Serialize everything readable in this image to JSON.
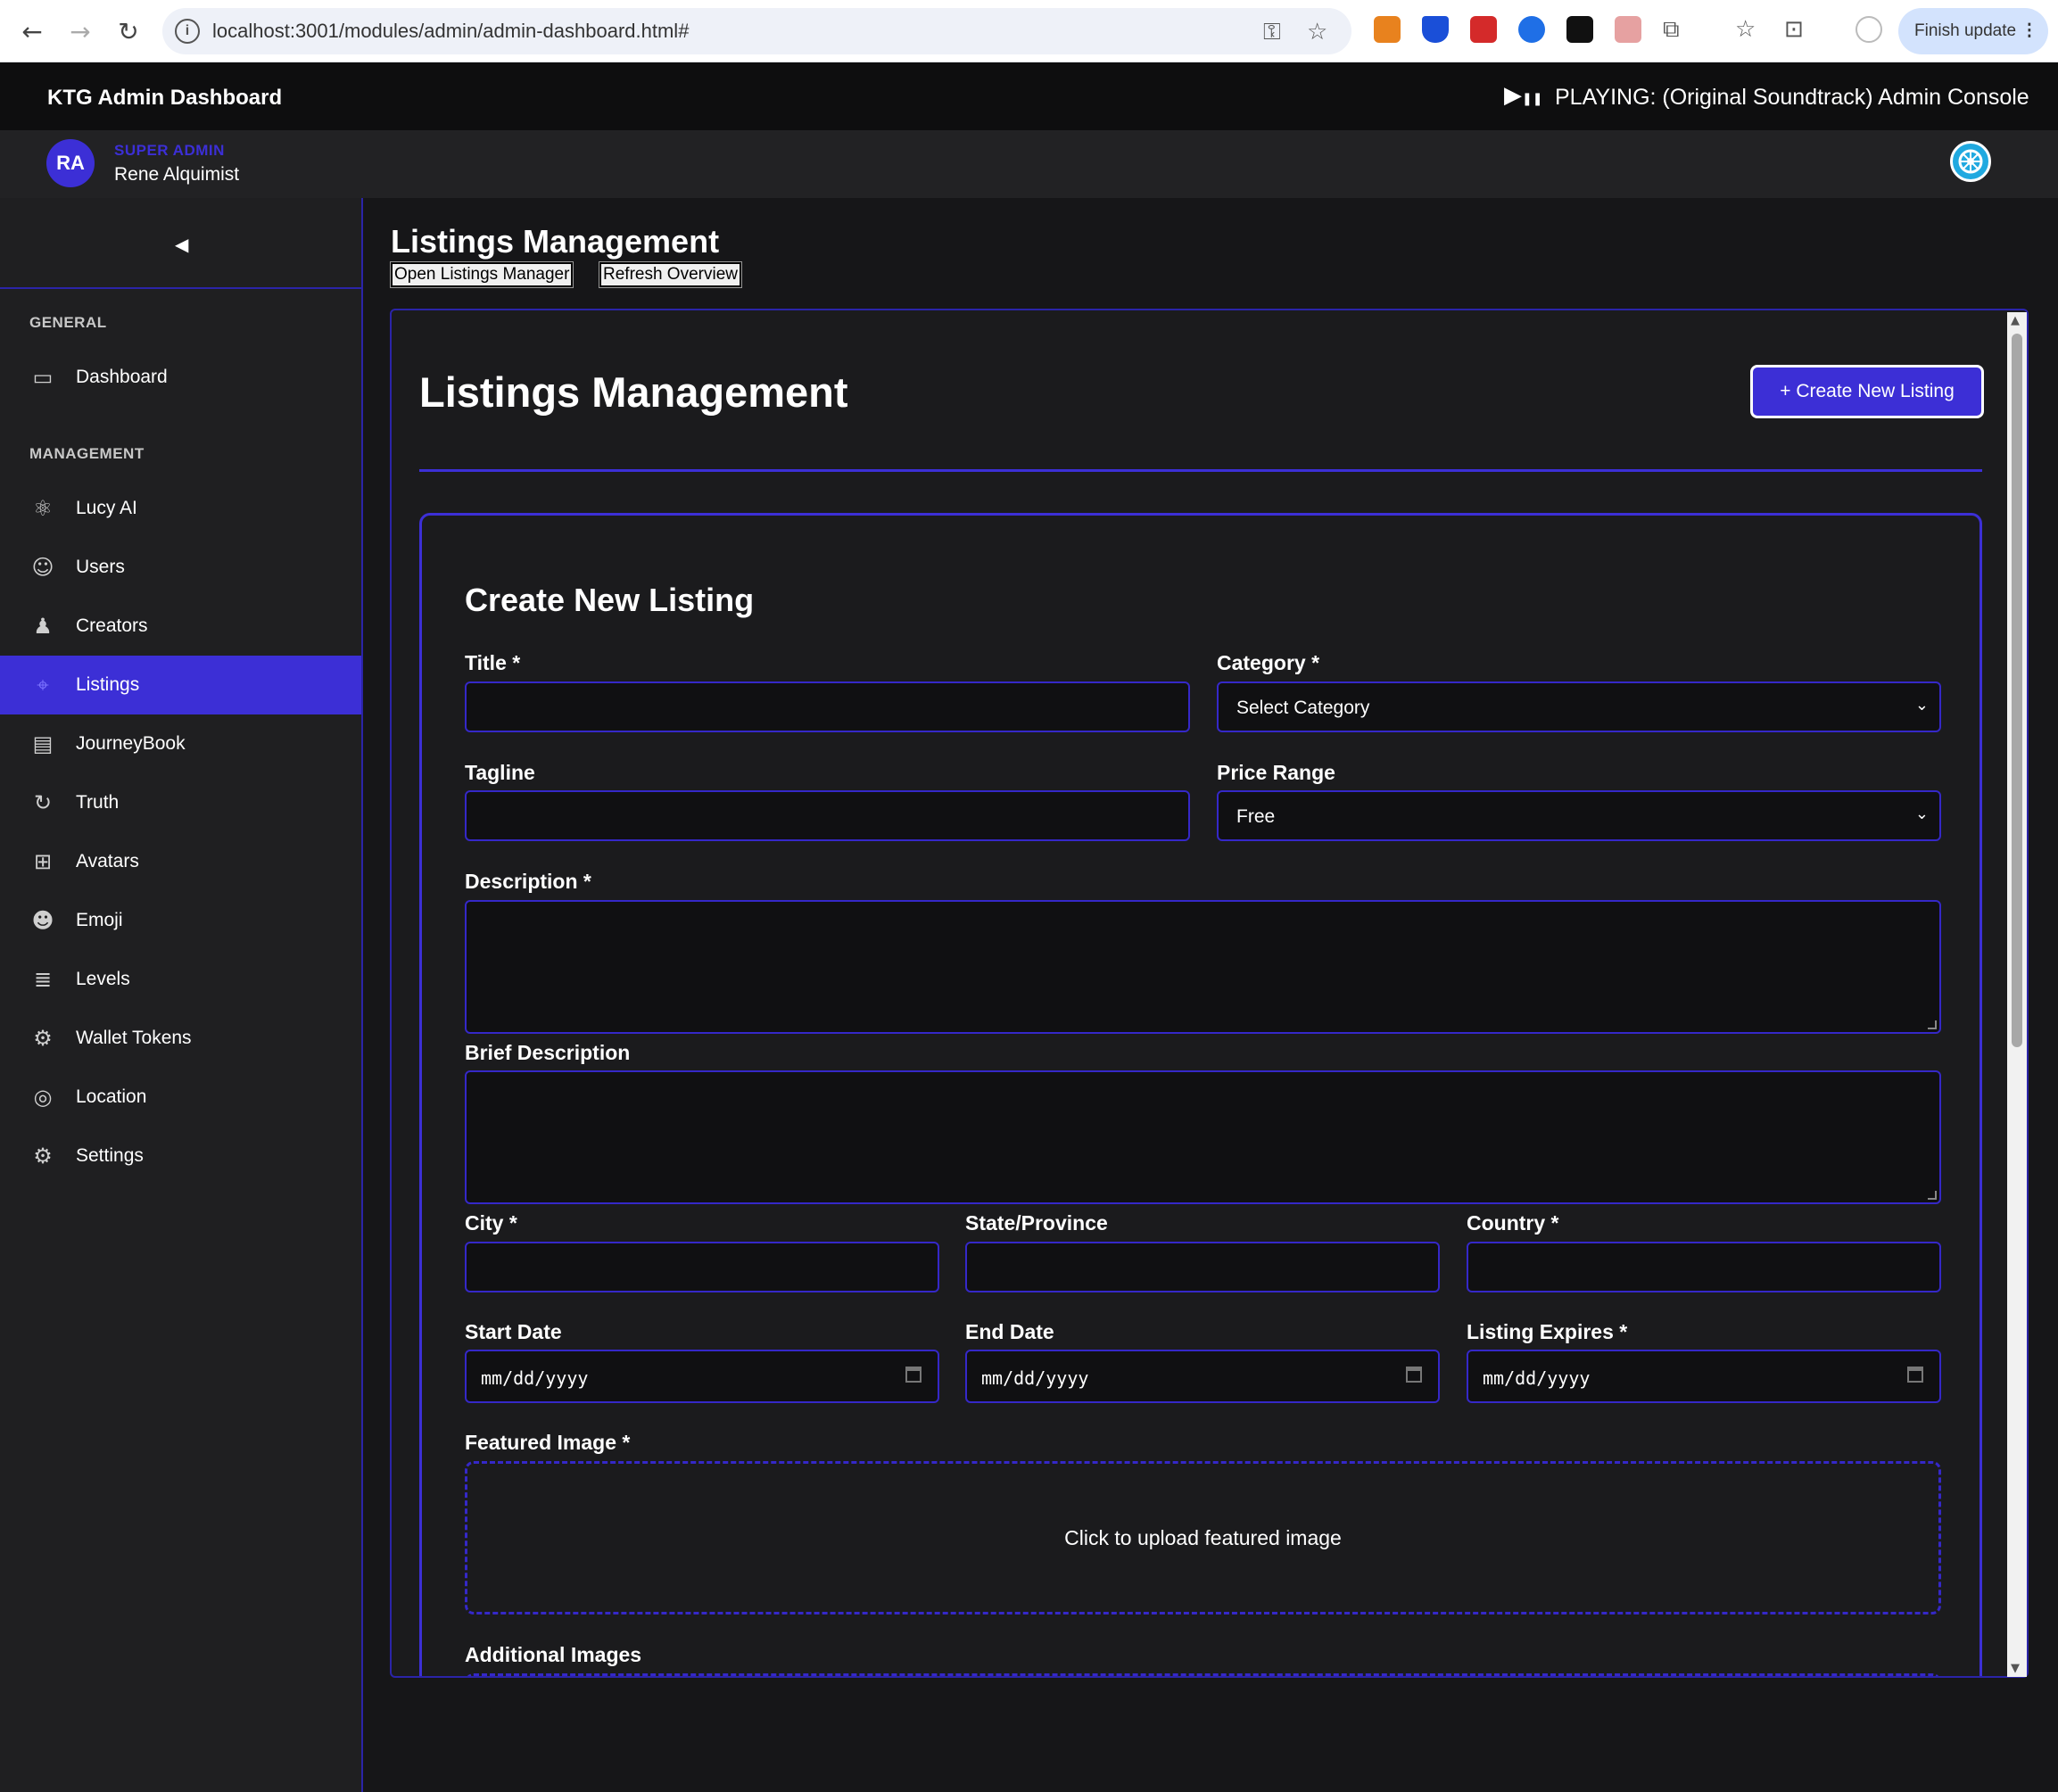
{
  "browser": {
    "url": "localhost:3001/modules/admin/admin-dashboard.html#",
    "finish_update": "Finish update"
  },
  "header": {
    "brand": "KTG Admin Dashboard",
    "now_playing": "PLAYING: (Original Soundtrack) Admin Console"
  },
  "user": {
    "initials": "RA",
    "role": "SUPER ADMIN",
    "name": "Rene Alquimist"
  },
  "sidebar": {
    "collapse_glyph": "◀",
    "general_heading": "GENERAL",
    "management_heading": "MANAGEMENT",
    "items": [
      {
        "label": "Dashboard",
        "icon": "dashboard-icon"
      },
      {
        "label": "Lucy AI",
        "icon": "atom-icon"
      },
      {
        "label": "Users",
        "icon": "user-icon"
      },
      {
        "label": "Creators",
        "icon": "group-icon"
      },
      {
        "label": "Listings",
        "icon": "target-icon",
        "active": true
      },
      {
        "label": "JourneyBook",
        "icon": "book-icon"
      },
      {
        "label": "Truth",
        "icon": "refresh-icon"
      },
      {
        "label": "Avatars",
        "icon": "grid-icon"
      },
      {
        "label": "Emoji",
        "icon": "alien-icon"
      },
      {
        "label": "Levels",
        "icon": "stack-icon"
      },
      {
        "label": "Wallet Tokens",
        "icon": "token-gear-icon"
      },
      {
        "label": "Location",
        "icon": "location-icon"
      },
      {
        "label": "Settings",
        "icon": "gears-icon"
      }
    ]
  },
  "content": {
    "title": "Listings Management",
    "open_manager": "Open Listings Manager",
    "refresh_overview": "Refresh Overview"
  },
  "panel": {
    "title": "Listings Management",
    "create_button": "+ Create New Listing"
  },
  "form": {
    "title": "Create New Listing",
    "title_label": "Title *",
    "category_label": "Category *",
    "category_value": "Select Category",
    "tagline_label": "Tagline",
    "price_label": "Price Range",
    "price_value": "Free",
    "description_label": "Description *",
    "brief_label": "Brief Description",
    "city_label": "City *",
    "state_label": "State/Province",
    "country_label": "Country *",
    "start_label": "Start Date",
    "end_label": "End Date",
    "expires_label": "Listing Expires *",
    "date_placeholder": "mm/dd/yyyy",
    "featured_label": "Featured Image *",
    "featured_prompt": "Click to upload featured image",
    "additional_label": "Additional Images"
  },
  "colors": {
    "accent": "#3c2fd6",
    "background": "#161618",
    "panel": "#1b1b1d"
  }
}
